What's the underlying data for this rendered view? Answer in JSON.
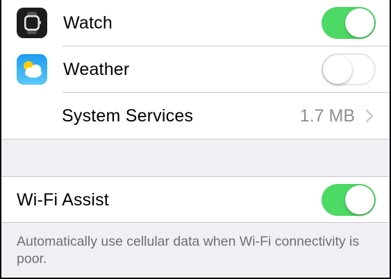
{
  "rows": {
    "watch": {
      "label": "Watch",
      "icon": "watch-app-icon",
      "enabled": true
    },
    "weather": {
      "label": "Weather",
      "icon": "weather-app-icon",
      "enabled": false
    },
    "system_services": {
      "label": "System Services",
      "value": "1.7 MB",
      "icon": "chevron-right-icon"
    }
  },
  "wifi_assist": {
    "label": "Wi-Fi Assist",
    "enabled": true,
    "footer": "Automatically use cellular data when Wi-Fi connectivity is poor."
  },
  "colors": {
    "toggle_on": "#4cd964",
    "background": "#efeff4",
    "separator": "#c8c7cc",
    "secondary_text": "#8e8e93",
    "footer_text": "#6d6d72"
  }
}
